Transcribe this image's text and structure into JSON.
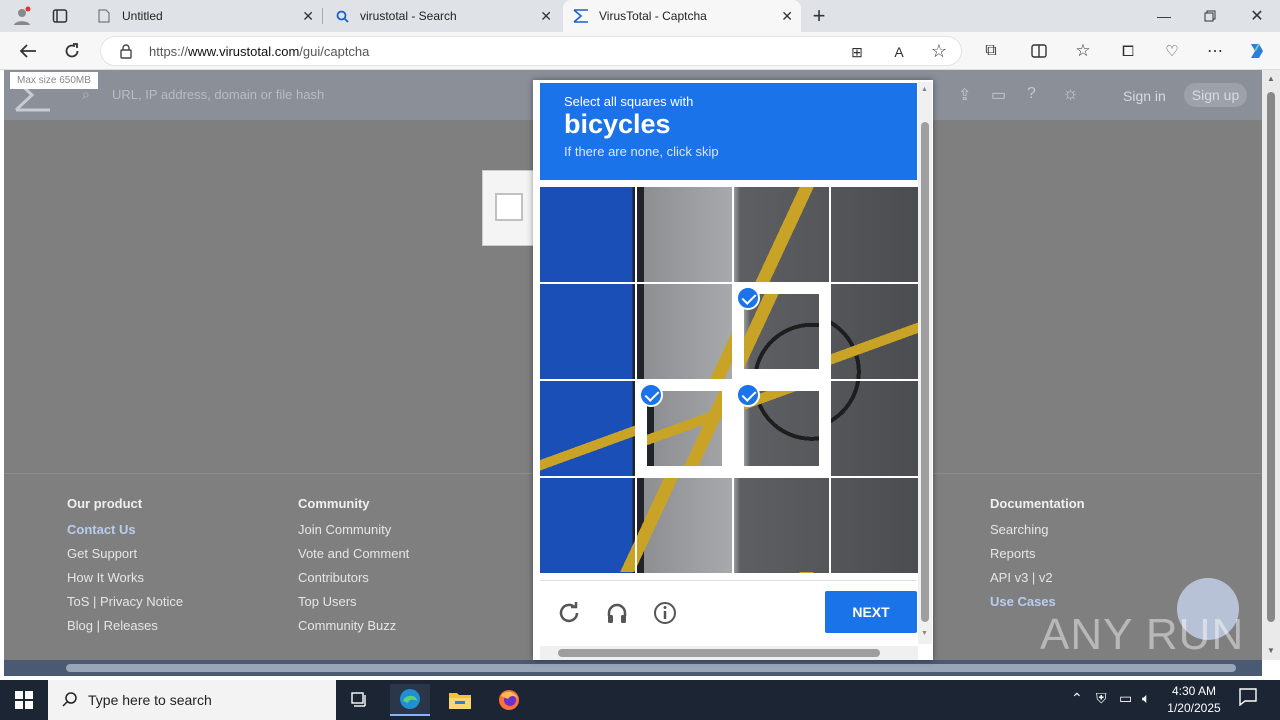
{
  "browser": {
    "tabs": [
      {
        "title": "Untitled",
        "icon": "page-icon"
      },
      {
        "title": "virustotal - Search",
        "icon": "search-icon"
      },
      {
        "title": "VirusTotal - Captcha",
        "icon": "virustotal-icon"
      }
    ],
    "url_prefix": "https://",
    "url_domain": "www.virustotal.com",
    "url_path": "/gui/captcha"
  },
  "page": {
    "max_size_badge": "Max size 650MB",
    "search_placeholder": "URL, IP address, domain or file hash",
    "sign_in": "Sign in",
    "sign_up": "Sign up",
    "footer": {
      "col1": {
        "title": "Our product",
        "items": [
          "Contact Us",
          "Get Support",
          "How It Works",
          "ToS | Privacy Notice",
          "Blog | Releases"
        ]
      },
      "col2": {
        "title": "Community",
        "items": [
          "Join Community",
          "Vote and Comment",
          "Contributors",
          "Top Users",
          "Community Buzz"
        ]
      },
      "col4": {
        "title": "Documentation",
        "items": [
          "Searching",
          "Reports",
          "API v3 | v2",
          "Use Cases"
        ]
      }
    },
    "watermark": "ANY RUN"
  },
  "captcha": {
    "instruction": "Select all squares with",
    "target": "bicycles",
    "hint": "If there are none, click skip",
    "next_label": "NEXT",
    "selected_cells": [
      6,
      9,
      10
    ],
    "accent": "#1a73e8"
  },
  "taskbar": {
    "search_placeholder": "Type here to search",
    "time": "4:30 AM",
    "date": "1/20/2025"
  }
}
